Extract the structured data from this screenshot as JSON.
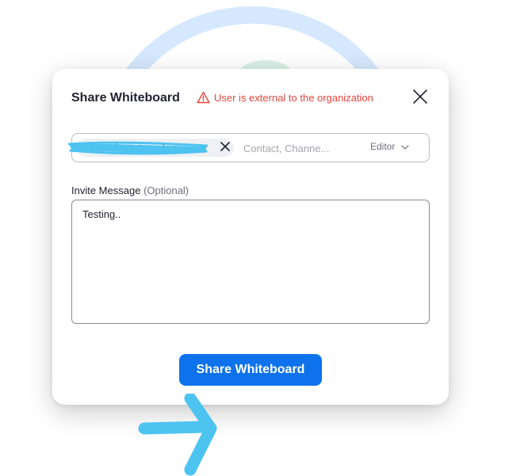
{
  "dialog": {
    "title": "Share Whiteboard",
    "warning": {
      "icon": "warning-triangle-icon",
      "text": "User is external to the organization",
      "color": "#e8453c"
    },
    "close_icon": "close-icon"
  },
  "invite": {
    "chip_label": "theteachertutoronline...",
    "chip_remove_icon": "close-icon",
    "contact_placeholder": "Contact, Channe...",
    "role": "Editor",
    "role_icon": "chevron-down-icon"
  },
  "message": {
    "label": "Invite Message",
    "optional": "(Optional)",
    "value": "Testing.."
  },
  "actions": {
    "share_label": "Share Whiteboard",
    "share_color": "#0e72ed"
  },
  "annotations": {
    "color": "#4dc3f0",
    "scribble": "highlighter-scribble",
    "arrow": "right-arrow-annotation"
  }
}
